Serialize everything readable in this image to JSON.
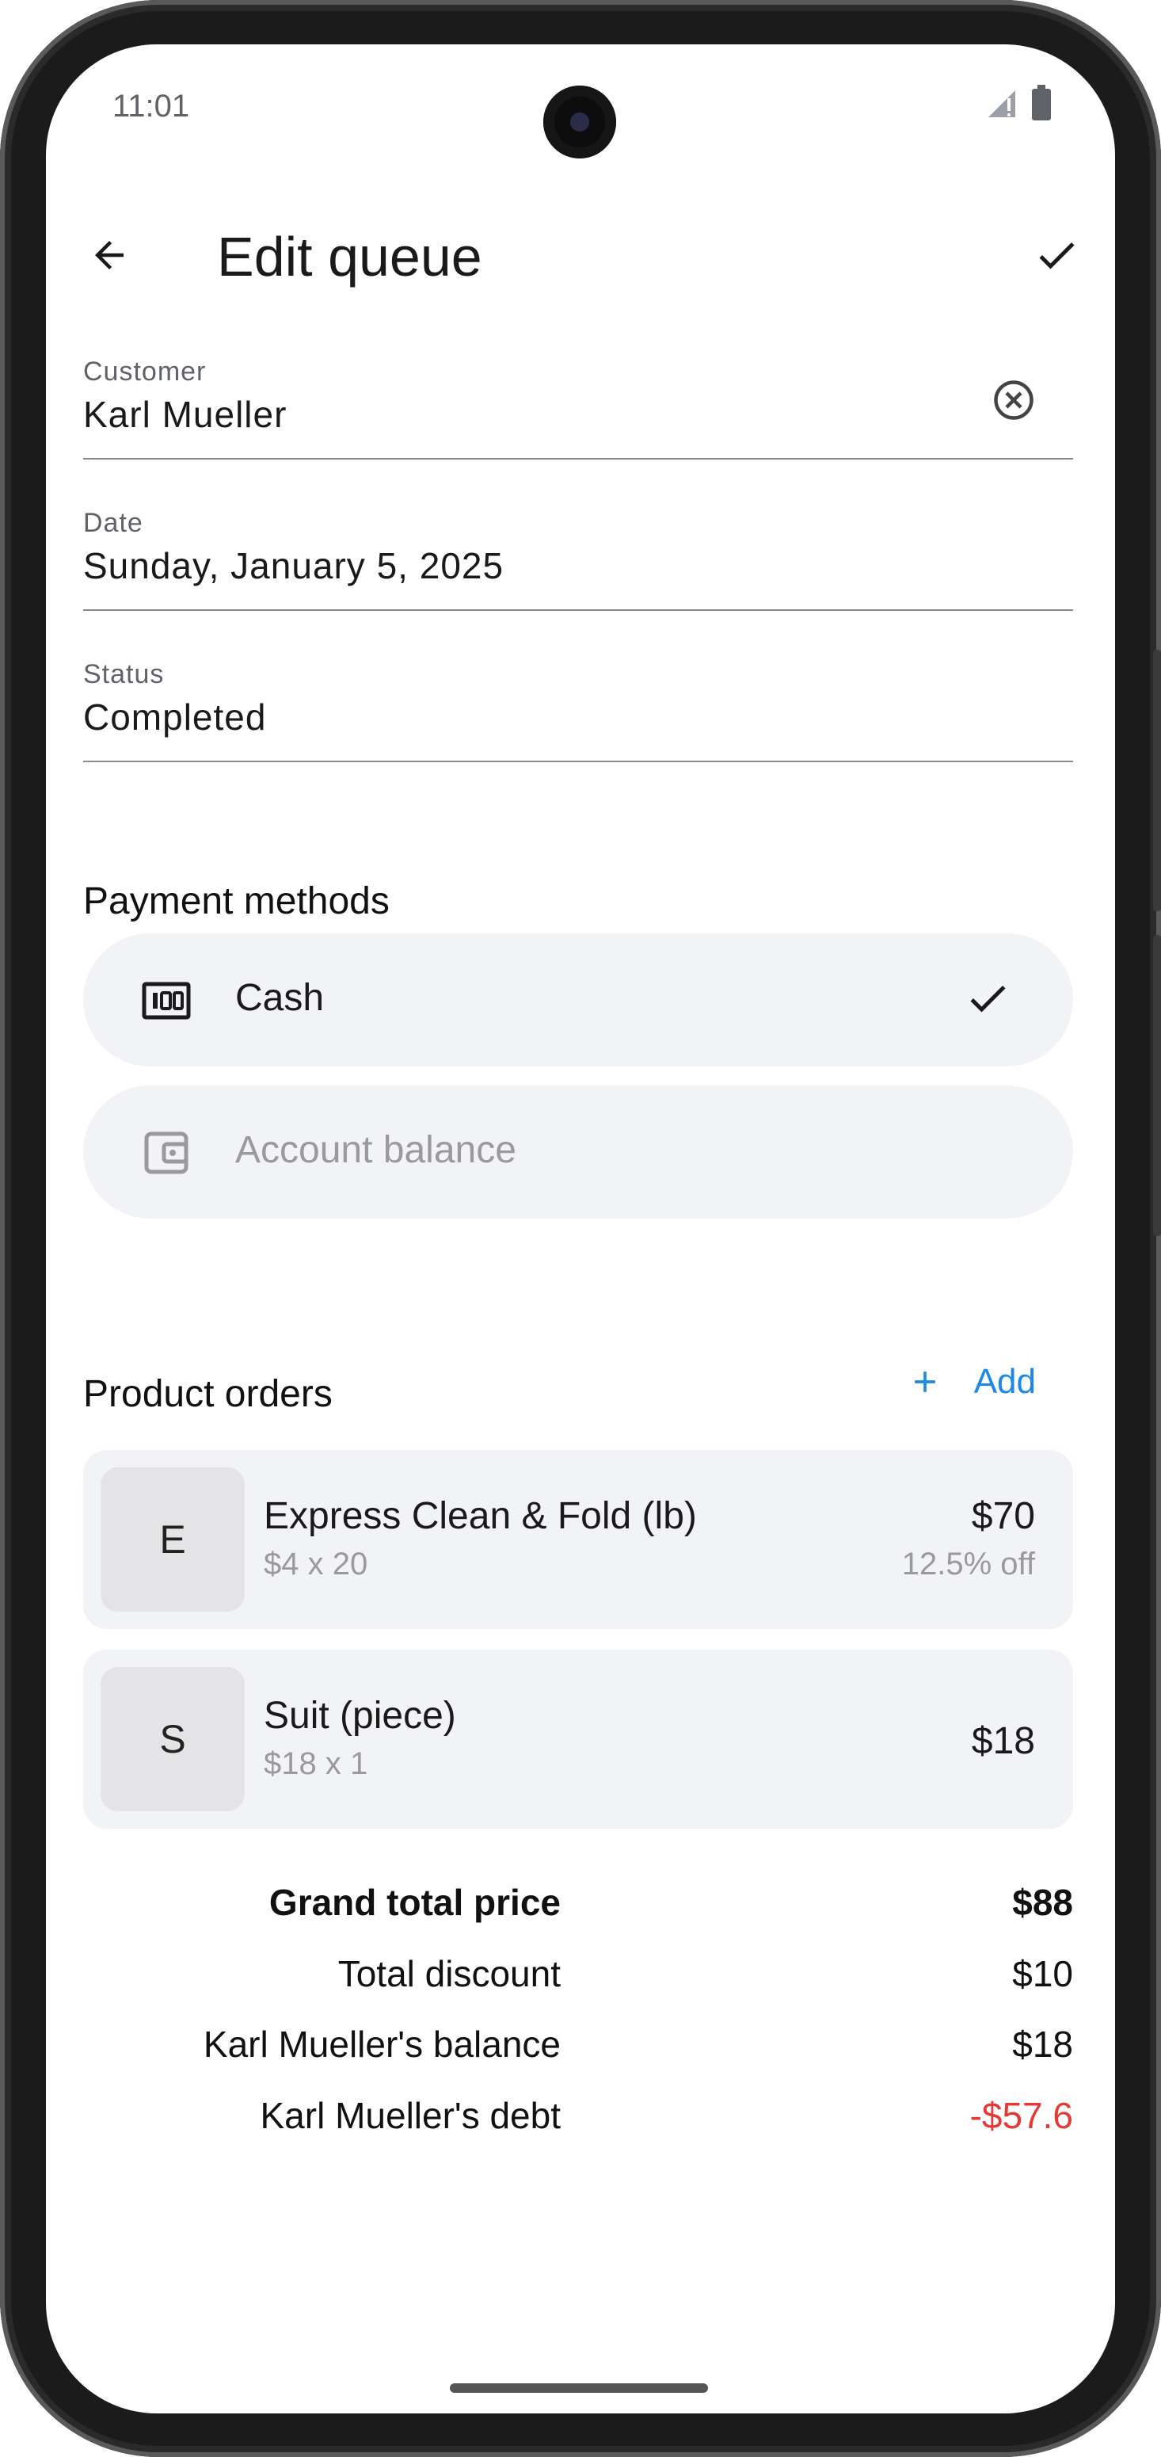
{
  "status_bar": {
    "time": "11:01",
    "signal_icon": "signal-icon",
    "battery_icon": "battery-icon"
  },
  "header": {
    "title": "Edit queue",
    "back_icon": "arrow-back-icon",
    "confirm_icon": "check-icon"
  },
  "form": {
    "customer": {
      "label": "Customer",
      "value": "Karl Mueller",
      "clear_icon": "cancel-circle-icon"
    },
    "date": {
      "label": "Date",
      "value": "Sunday, January 5, 2025"
    },
    "status": {
      "label": "Status",
      "value": "Completed"
    }
  },
  "payment_methods": {
    "title": "Payment methods",
    "items": [
      {
        "label": "Cash",
        "icon": "cash-icon",
        "selected": true
      },
      {
        "label": "Account balance",
        "icon": "wallet-icon",
        "selected": false
      }
    ]
  },
  "product_orders": {
    "title": "Product orders",
    "add_label": "Add",
    "items": [
      {
        "initial": "E",
        "name": "Express Clean & Fold (lb)",
        "detail": "$4 x 20",
        "price": "$70",
        "discount": "12.5% off"
      },
      {
        "initial": "S",
        "name": "Suit (piece)",
        "detail": "$18 x 1",
        "price": "$18",
        "discount": ""
      }
    ]
  },
  "summary": {
    "grand_total_label": "Grand total price",
    "grand_total_value": "$88",
    "discount_label": "Total discount",
    "discount_value": "$10",
    "balance_label": "Karl Mueller's balance",
    "balance_value": "$18",
    "debt_label": "Karl Mueller's debt",
    "debt_value": "-$57.6"
  },
  "colors": {
    "accent": "#1e88e5",
    "debt": "#e53935",
    "chip_bg": "#f2f3f6"
  }
}
